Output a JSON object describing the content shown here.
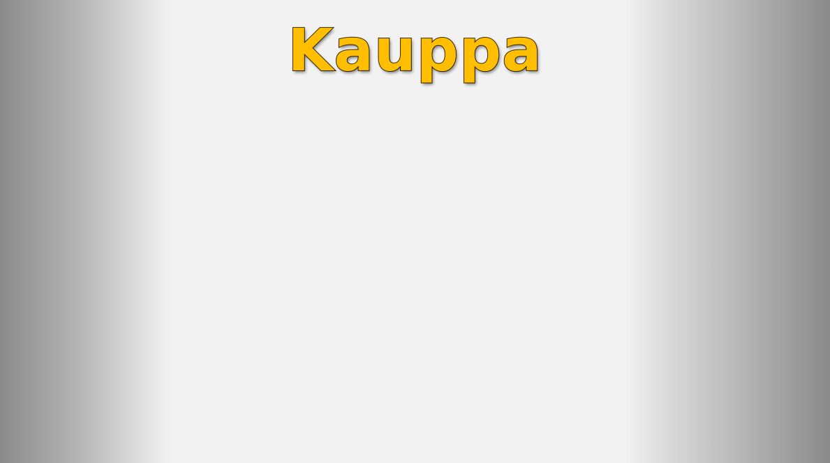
{
  "slide": {
    "title": "Kauppa",
    "title_color": "#ffbf00"
  }
}
